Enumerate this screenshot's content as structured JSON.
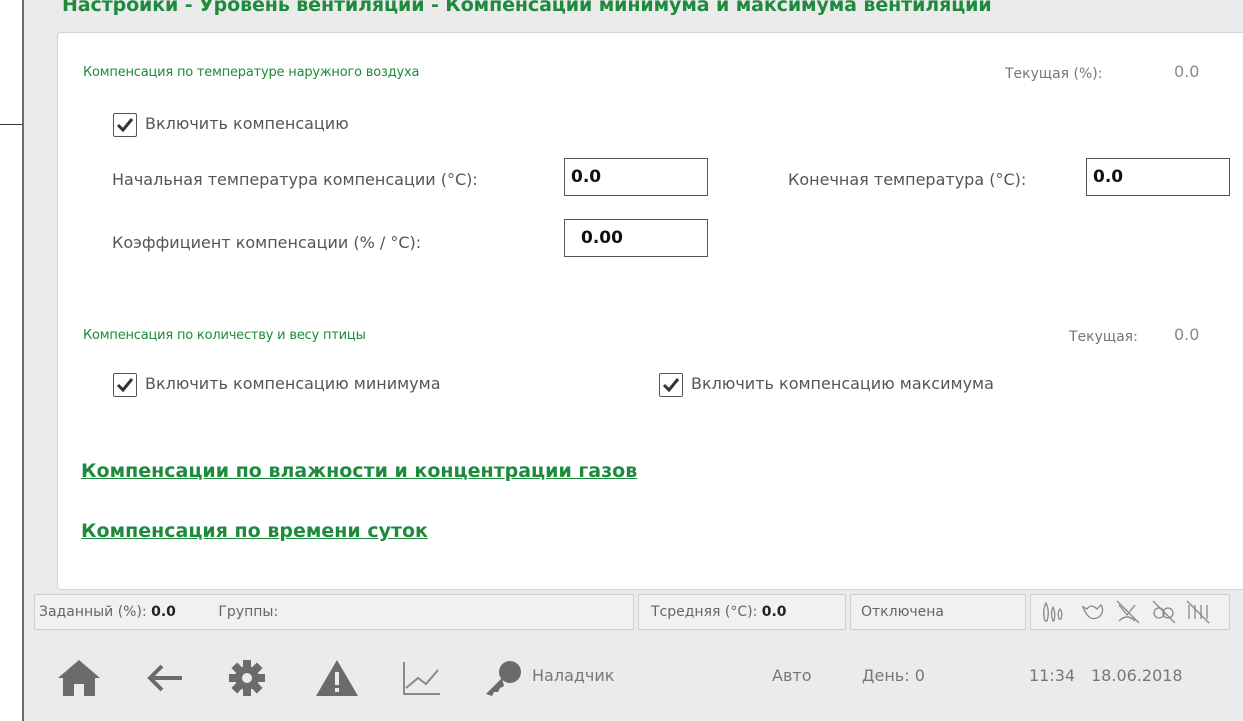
{
  "page_title": "Настройки - Уровень вентиляции - Компенсации минимума и максимума вентиляции",
  "outdoor_section": {
    "title": "Компенсация по температуре наружного воздуха",
    "current_label": "Текущая (%):",
    "current_value": "0.0",
    "enable_label": "Включить компенсацию",
    "enable_checked": true,
    "start_temp_label": "Начальная температура компенсации (°C):",
    "start_temp_value": "0.0",
    "end_temp_label": "Конечная температура (°C):",
    "end_temp_value": "0.0",
    "coef_label": "Коэффициент компенсации (% / °C):",
    "coef_value": "0.00"
  },
  "bird_section": {
    "title": "Компенсация по количеству и весу птицы",
    "current_label": "Текущая:",
    "current_value": "0.0",
    "enable_min_label": "Включить компенсацию минимума",
    "enable_min_checked": true,
    "enable_max_label": "Включить компенсацию максимума",
    "enable_max_checked": true
  },
  "links": {
    "humidity_gas": "Компенсации по влажности и концентрации газов",
    "time_of_day": "Компенсация по времени суток"
  },
  "status_bar": {
    "setpoint_label": "Заданный (%):",
    "setpoint_value": "0.0",
    "groups_label": "Группы:",
    "tavg_label": "Тсредняя (°C):",
    "tavg_value": "0.0",
    "state": "Отключена",
    "status_icons": [
      "humidity-icon",
      "bird-icon",
      "fan-off-icon",
      "gas-off-icon",
      "light-off-icon"
    ]
  },
  "bottom_nav": {
    "icons": [
      "home-icon",
      "back-arrow-icon",
      "gear-icon",
      "warning-icon",
      "chart-icon",
      "key-icon"
    ],
    "user": "Наладчик",
    "mode": "Авто",
    "day": "День: 0",
    "time": "11:34",
    "date": "18.06.2018"
  },
  "colors": {
    "accent_green": "#1e8a3c",
    "icon_gray": "#6b6b6b"
  }
}
